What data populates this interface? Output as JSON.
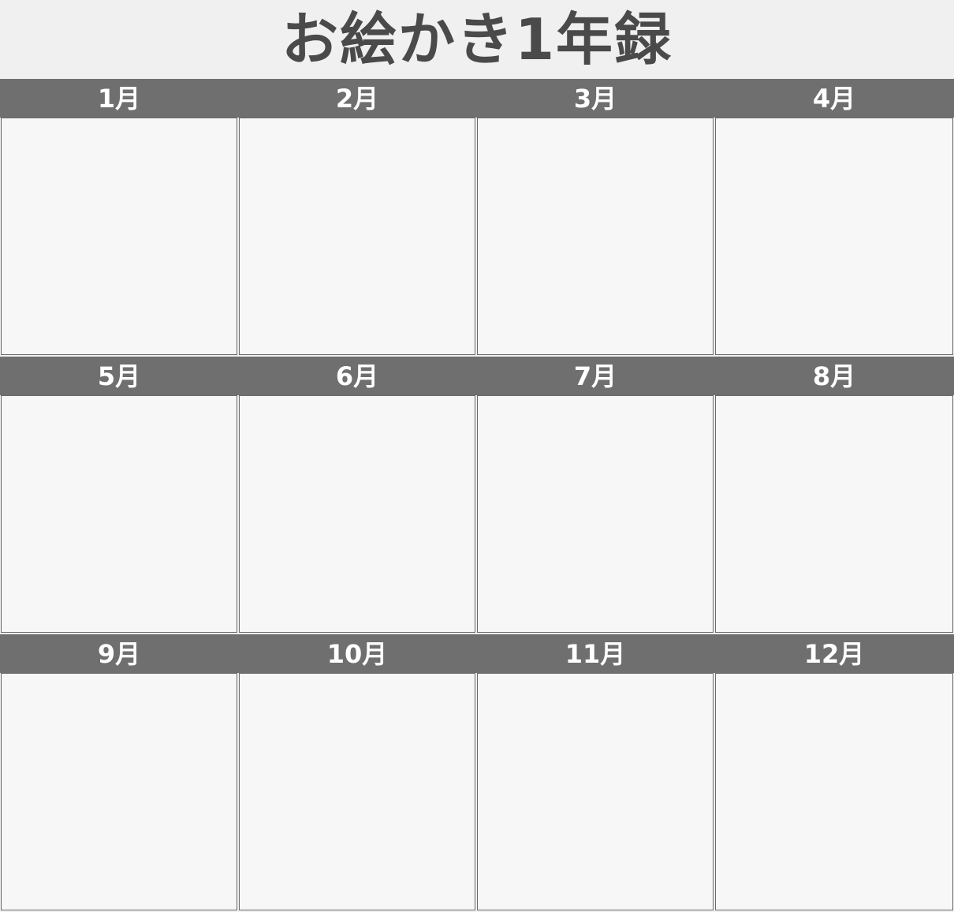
{
  "title": "お絵かき1年録",
  "months": [
    "1月",
    "2月",
    "3月",
    "4月",
    "5月",
    "6月",
    "7月",
    "8月",
    "9月",
    "10月",
    "11月",
    "12月"
  ]
}
